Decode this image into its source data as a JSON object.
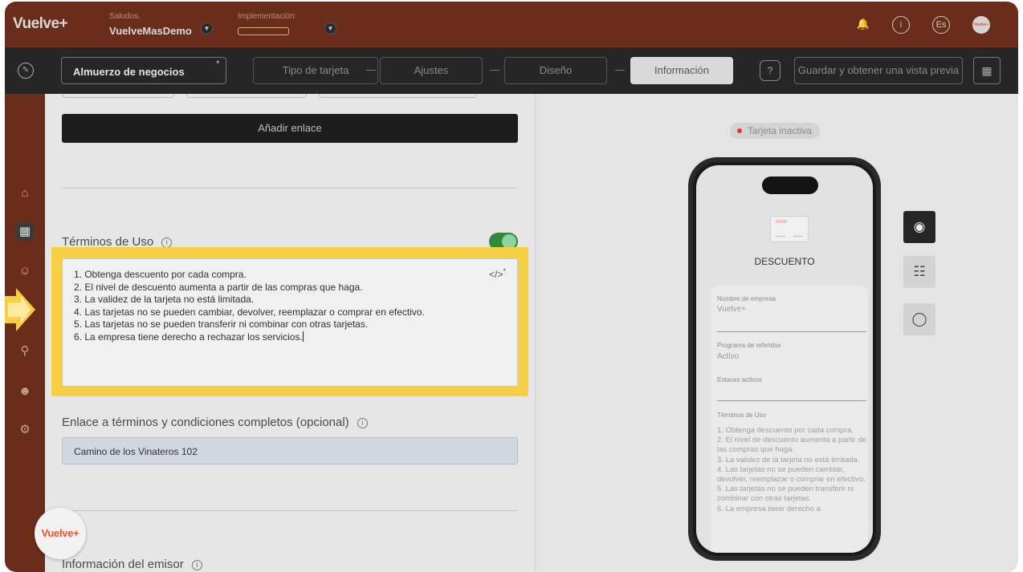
{
  "header": {
    "brand": "Vuelve+",
    "greeting_label": "Saludos,",
    "account_name": "VuelveMasDemo",
    "implementation_label": "Implementación:",
    "lang_label": "Es",
    "avatar_text": "Vuelve+"
  },
  "toolbar": {
    "card_name": "Almuerzo de negocios",
    "card_name_marker": "*",
    "steps": [
      "Tipo de tarjeta",
      "Ajustes",
      "Diseño",
      "Información"
    ],
    "active_step": "Información",
    "help": "?",
    "save_label": "Guardar y obtener una vista previa"
  },
  "form": {
    "add_link_label": "Añadir enlace",
    "terms_title": "Términos de Uso",
    "terms_enabled": true,
    "terms_lines": [
      "1. Obtenga descuento por cada compra.",
      "2. El nivel de descuento aumenta a partir de las compras que haga.",
      "3. La validez de la tarjeta no está limitada.",
      "4. Las tarjetas no se pueden cambiar, devolver, reemplazar o comprar en efectivo.",
      "5. Las tarjetas no se pueden transferir ni combinar con otras tarjetas.",
      "6. La empresa tiene derecho a rechazar los servicios."
    ],
    "code_icon": "</>",
    "code_marker": "*",
    "terms_link_title": "Enlace a términos y condiciones completos (opcional)",
    "terms_link_value": "Camino de los Vinateros 102",
    "issuer_title": "Información del emisor"
  },
  "floating_logo": "Vuelve+",
  "preview": {
    "status": "Tarjeta inactiva",
    "status_color": "#e23a2a",
    "card_label": "DESCUENTO",
    "company_label": "Nombre de empresa",
    "company_value": "Vuelve+",
    "referral_label": "Programa de referidos",
    "referral_value": "Activo",
    "links_label": "Enlaces activos",
    "terms_label": "Términos de Uso",
    "terms_text": "1. Obtenga descuento por cada compra.\n2. El nivel de descuento aumenta a partir de las compras que haga.\n3. La validez de la tarjeta no está limitada.\n4. Las tarjetas no se pueden cambiar, devolver, reemplazar o comprar en efectivo.\n5. Las tarjetas no se pueden transferir ni combinar con otras tarjetas.\n6. La empresa tiene derecho a"
  },
  "platforms": [
    "apple-icon",
    "android-icon",
    "chat-icon"
  ],
  "colors": {
    "header_bg": "#6a2d1b",
    "toolbar_bg": "#262626",
    "highlight": "#f6cf45",
    "toggle_on": "#2f8a3c",
    "brand_orange": "#e5532c"
  }
}
